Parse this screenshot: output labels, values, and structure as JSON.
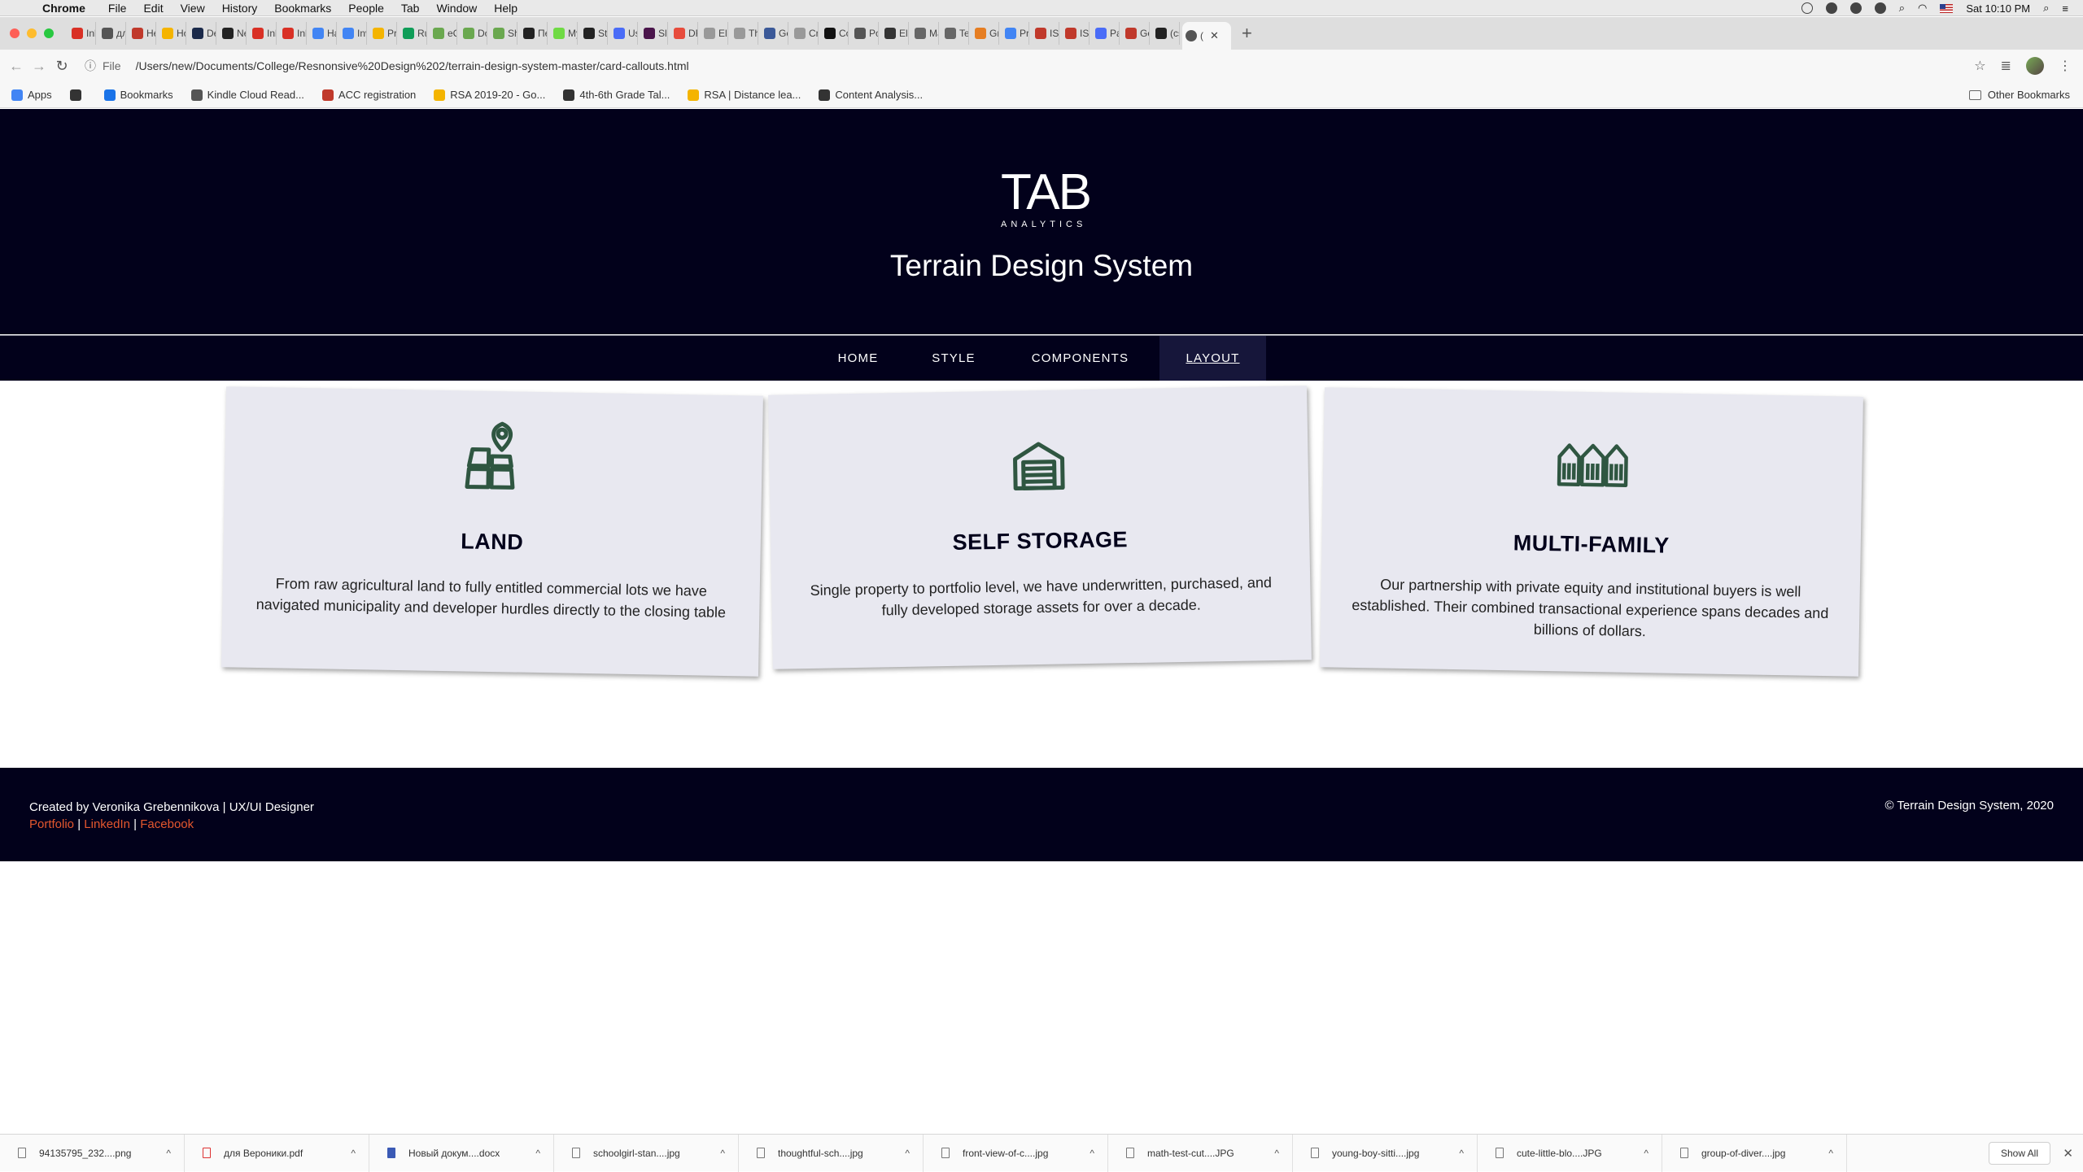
{
  "menubar": {
    "app": "Chrome",
    "items": [
      "File",
      "Edit",
      "View",
      "History",
      "Bookmarks",
      "People",
      "Tab",
      "Window",
      "Help"
    ],
    "clock": "Sat 10:10 PM"
  },
  "tabs": [
    {
      "label": "Inb",
      "color": "#d93025"
    },
    {
      "label": "для",
      "color": "#555555"
    },
    {
      "label": "Hea",
      "color": "#c0392b"
    },
    {
      "label": "Hor",
      "color": "#f5b400"
    },
    {
      "label": "Dec",
      "color": "#1b2a4a"
    },
    {
      "label": "Nex",
      "color": "#222222"
    },
    {
      "label": "Inb",
      "color": "#d93025"
    },
    {
      "label": "Inb",
      "color": "#d93025"
    },
    {
      "label": "Har",
      "color": "#4285f4"
    },
    {
      "label": "Inv",
      "color": "#4285f4"
    },
    {
      "label": "Pre",
      "color": "#f4b400"
    },
    {
      "label": "Rus",
      "color": "#0f9d58"
    },
    {
      "label": "eCo",
      "color": "#6aa84f"
    },
    {
      "label": "Dov",
      "color": "#6aa84f"
    },
    {
      "label": "Sho",
      "color": "#6aa84f"
    },
    {
      "label": "Пер",
      "color": "#222222"
    },
    {
      "label": "My",
      "color": "#6fda44"
    },
    {
      "label": "Stri",
      "color": "#222222"
    },
    {
      "label": "Use",
      "color": "#4a6cf7"
    },
    {
      "label": "Slac",
      "color": "#4a154b"
    },
    {
      "label": "DFS",
      "color": "#e74c3c"
    },
    {
      "label": "Elei",
      "color": "#999999"
    },
    {
      "label": "The",
      "color": "#999999"
    },
    {
      "label": "Get",
      "color": "#3b5998"
    },
    {
      "label": "Cre",
      "color": "#999999"
    },
    {
      "label": "Cor",
      "color": "#111111"
    },
    {
      "label": "Poc",
      "color": "#555555"
    },
    {
      "label": "Ele",
      "color": "#333333"
    },
    {
      "label": "Mar",
      "color": "#666666"
    },
    {
      "label": "Tes",
      "color": "#666666"
    },
    {
      "label": "Grid",
      "color": "#e67e22"
    },
    {
      "label": "Pro",
      "color": "#4285f4"
    },
    {
      "label": "ISO",
      "color": "#c0392b"
    },
    {
      "label": "ISO",
      "color": "#c0392b"
    },
    {
      "label": "Pag",
      "color": "#4a6cf7"
    },
    {
      "label": "Goo",
      "color": "#c0392b"
    },
    {
      "label": "(csi",
      "color": "#222222"
    }
  ],
  "active_tab": {
    "label": "(",
    "close": "✕"
  },
  "address_bar": {
    "scheme": "File",
    "url": "/Users/new/Documents/College/Resnonsive%20Design%202/terrain-design-system-master/card-callouts.html"
  },
  "bookmarks": [
    {
      "label": "Apps",
      "color": "#4285f4"
    },
    {
      "label": "",
      "color": "#333333"
    },
    {
      "label": "Bookmarks",
      "color": "#1a73e8"
    },
    {
      "label": "Kindle Cloud Read...",
      "color": "#555555"
    },
    {
      "label": "ACC registration",
      "color": "#c0392b"
    },
    {
      "label": "RSA 2019-20 - Go...",
      "color": "#f4b400"
    },
    {
      "label": "4th-6th Grade Tal...",
      "color": "#333333"
    },
    {
      "label": "RSA | Distance lea...",
      "color": "#f4b400"
    },
    {
      "label": "Content Analysis...",
      "color": "#333333"
    }
  ],
  "other_bookmarks": "Other Bookmarks",
  "site": {
    "logo_mark": "TAB",
    "logo_sub": "ANALYTICS",
    "title": "Terrain Design System",
    "nav": [
      "HOME",
      "STYLE",
      "COMPONENTS",
      "LAYOUT"
    ],
    "active_nav": "LAYOUT"
  },
  "cards": [
    {
      "icon": "land-map-pin-icon",
      "title": "LAND",
      "text": "From raw agricultural land to fully entitled commercial lots we have navigated municipality and developer hurdles directly to the closing table"
    },
    {
      "icon": "storage-unit-icon",
      "title": "SELF STORAGE",
      "text": "Single property to portfolio level, we have underwritten, purchased, and fully developed storage assets for over a decade."
    },
    {
      "icon": "multi-family-houses-icon",
      "title": "MULTI-FAMILY",
      "text": "Our partnership with private equity and institutional buyers is well established. Their combined transactional experience spans decades and billions of dollars."
    }
  ],
  "footer": {
    "credit": "Created by Veronika Grebennikova | UX/UI Designer",
    "links": [
      "Portfolio",
      "LinkedIn",
      "Facebook"
    ],
    "separator": "|",
    "copyright": "© Terrain Design System, 2020"
  },
  "downloads": [
    {
      "name": "94135795_232....png",
      "type": "img"
    },
    {
      "name": "для Вероники.pdf",
      "type": "pdf"
    },
    {
      "name": "Новый докум....docx",
      "type": "doc"
    },
    {
      "name": "schoolgirl-stan....jpg",
      "type": "img"
    },
    {
      "name": "thoughtful-sch....jpg",
      "type": "img"
    },
    {
      "name": "front-view-of-c....jpg",
      "type": "img"
    },
    {
      "name": "math-test-cut....JPG",
      "type": "img"
    },
    {
      "name": "young-boy-sitti....jpg",
      "type": "img"
    },
    {
      "name": "cute-little-blo....JPG",
      "type": "img"
    },
    {
      "name": "group-of-diver....jpg",
      "type": "img"
    }
  ],
  "show_all": "Show All",
  "colors": {
    "header_bg": "#02011b",
    "card_bg": "#e8e8f0",
    "icon_green": "#2f5641",
    "footer_link": "#e4572e"
  }
}
